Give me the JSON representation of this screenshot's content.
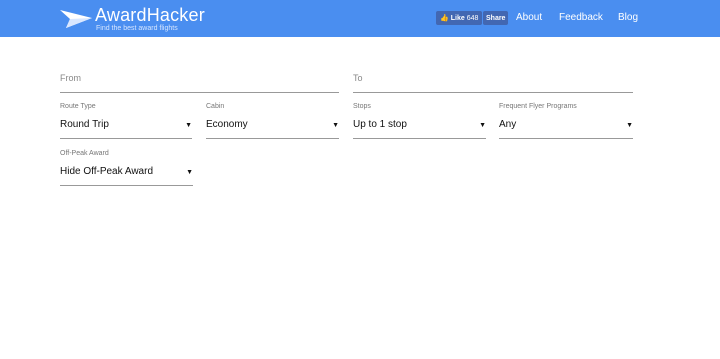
{
  "brand": {
    "name": "AwardHacker",
    "tagline": "Find the best award flights"
  },
  "social": {
    "like_label": "Like",
    "like_count": "648",
    "share_label": "Share"
  },
  "nav": {
    "about": "About",
    "feedback": "Feedback",
    "blog": "Blog"
  },
  "search": {
    "from_placeholder": "From",
    "to_placeholder": "To",
    "route_type": {
      "label": "Route Type",
      "value": "Round Trip"
    },
    "cabin": {
      "label": "Cabin",
      "value": "Economy"
    },
    "stops": {
      "label": "Stops",
      "value": "Up to 1 stop"
    },
    "programs": {
      "label": "Frequent Flyer Programs",
      "value": "Any"
    },
    "off_peak": {
      "label": "Off-Peak Award",
      "value": "Hide Off-Peak Award"
    }
  },
  "colors": {
    "header_bg": "#4a8ef0",
    "facebook": "#4267b2"
  },
  "icons": [
    "paper-plane-icon",
    "thumbs-up-icon",
    "caret-down-icon"
  ]
}
